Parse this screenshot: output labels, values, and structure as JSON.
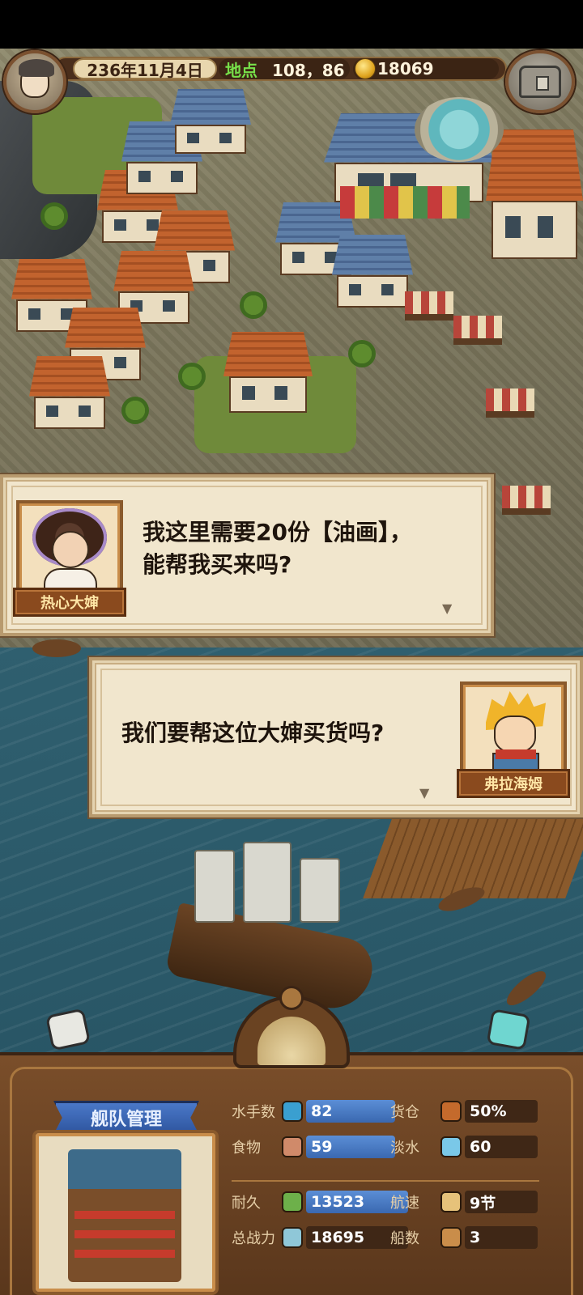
{
  "hud": {
    "date": "236年11月4日",
    "location_label": "地点",
    "location_coords": "108，86",
    "gold": "18069"
  },
  "dialogs": [
    {
      "speaker": "热心大婶",
      "lines": [
        "我这里需要20份【油画】，",
        "能帮我买来吗?"
      ]
    },
    {
      "speaker": "弗拉海姆",
      "lines": [
        "我们要帮这位大婶买货吗?"
      ]
    }
  ],
  "fleet": {
    "title": "舰队管理",
    "stats": {
      "sailors": {
        "label": "水手数",
        "value": "82"
      },
      "cargo": {
        "label": "货仓",
        "value": "50%"
      },
      "food": {
        "label": "食物",
        "value": "59"
      },
      "water": {
        "label": "淡水",
        "value": "60"
      },
      "durability": {
        "label": "耐久",
        "value": "13523"
      },
      "speed": {
        "label": "航速",
        "value": "9节"
      },
      "power": {
        "label": "总战力",
        "value": "18695"
      },
      "ships": {
        "label": "船数",
        "value": "3"
      }
    }
  },
  "icons": {
    "next_arrow": "▼",
    "avatar": "player-avatar-icon",
    "chest": "treasure-chest-icon",
    "coin": "gold-coin-icon"
  }
}
